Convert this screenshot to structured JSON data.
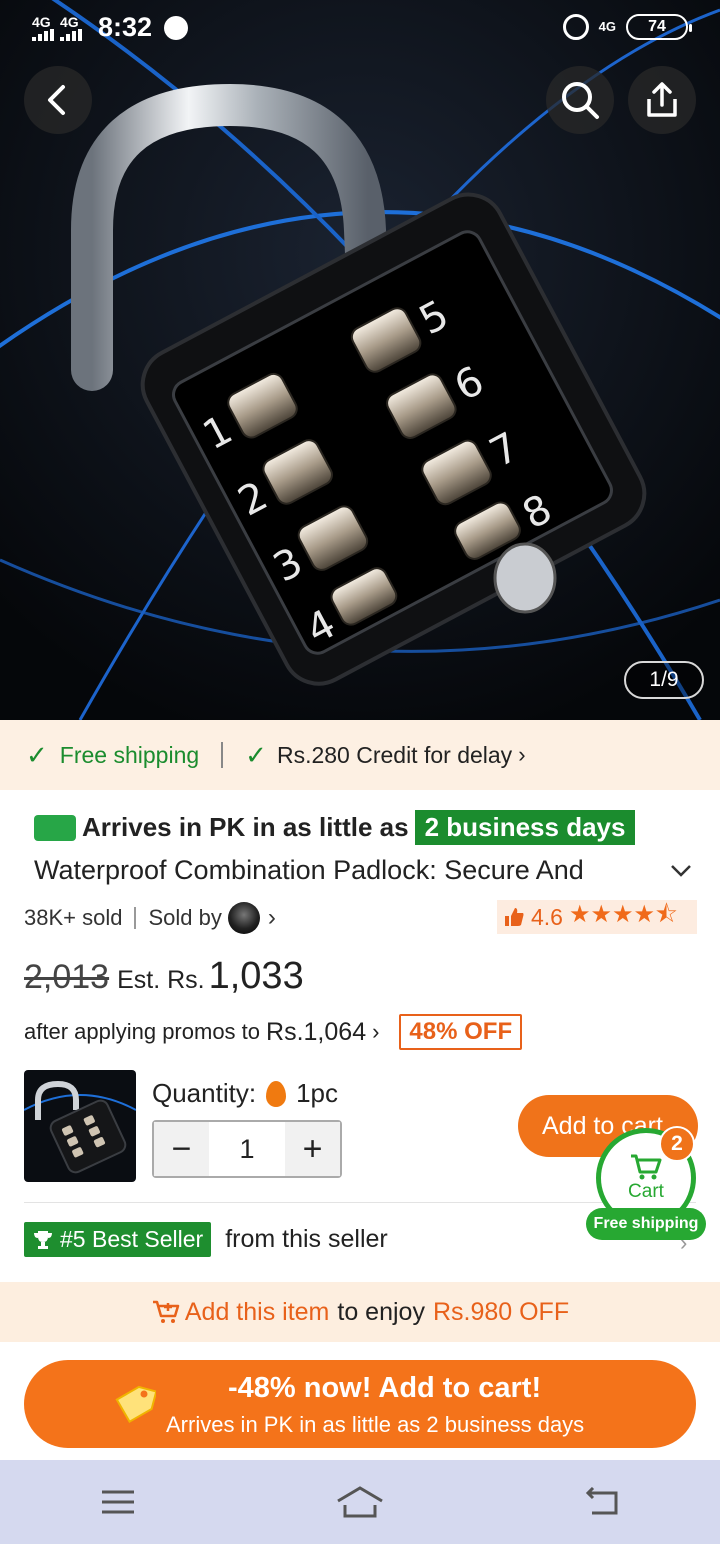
{
  "status_bar": {
    "network_left_1": "4G",
    "network_left_2": "4G",
    "time": "8:32",
    "network_right": "4G",
    "battery": "74"
  },
  "gallery": {
    "counter": "1/9",
    "image_icon": "combination-padlock-photo"
  },
  "header_icons": {
    "back": "back-arrow-icon",
    "search": "search-icon",
    "share": "share-icon"
  },
  "shipping_bar": {
    "free_shipping": "Free shipping",
    "credit_for_delay": "Rs.280 Credit for delay"
  },
  "delivery": {
    "prefix": "Arrives in PK in as little as",
    "days": "2 business days"
  },
  "product": {
    "title": "Waterproof Combination Padlock: Secure And",
    "sold": "38K+ sold",
    "sold_by": "Sold by",
    "rating": "4.6",
    "rating_value": 4.6
  },
  "price": {
    "original": "2,013",
    "est_label": "Est. Rs.",
    "current": "1,033"
  },
  "promo": {
    "text": "after applying promos to",
    "amount": "Rs.1,064",
    "discount": "48% OFF"
  },
  "quantity": {
    "label": "Quantity:",
    "unit": "1pc",
    "value": "1",
    "minus": "−",
    "plus": "+"
  },
  "cart": {
    "add_to_cart": "Add to cart",
    "cart_label": "Cart",
    "cart_count": "2",
    "free_shipping_badge": "Free shipping"
  },
  "best_seller": {
    "badge": "#5 Best Seller",
    "text": "from this seller"
  },
  "promo_strip": {
    "highlight": "Add this item",
    "middle": "to enjoy",
    "amount": "Rs.980 OFF"
  },
  "bottom_cta": {
    "line1": "-48% now! Add to cart!",
    "line2": "Arrives in PK in as little as 2 business days"
  },
  "colors": {
    "orange": "#f4731a",
    "green": "#1b8c2e",
    "cream": "#fdf0e3"
  }
}
